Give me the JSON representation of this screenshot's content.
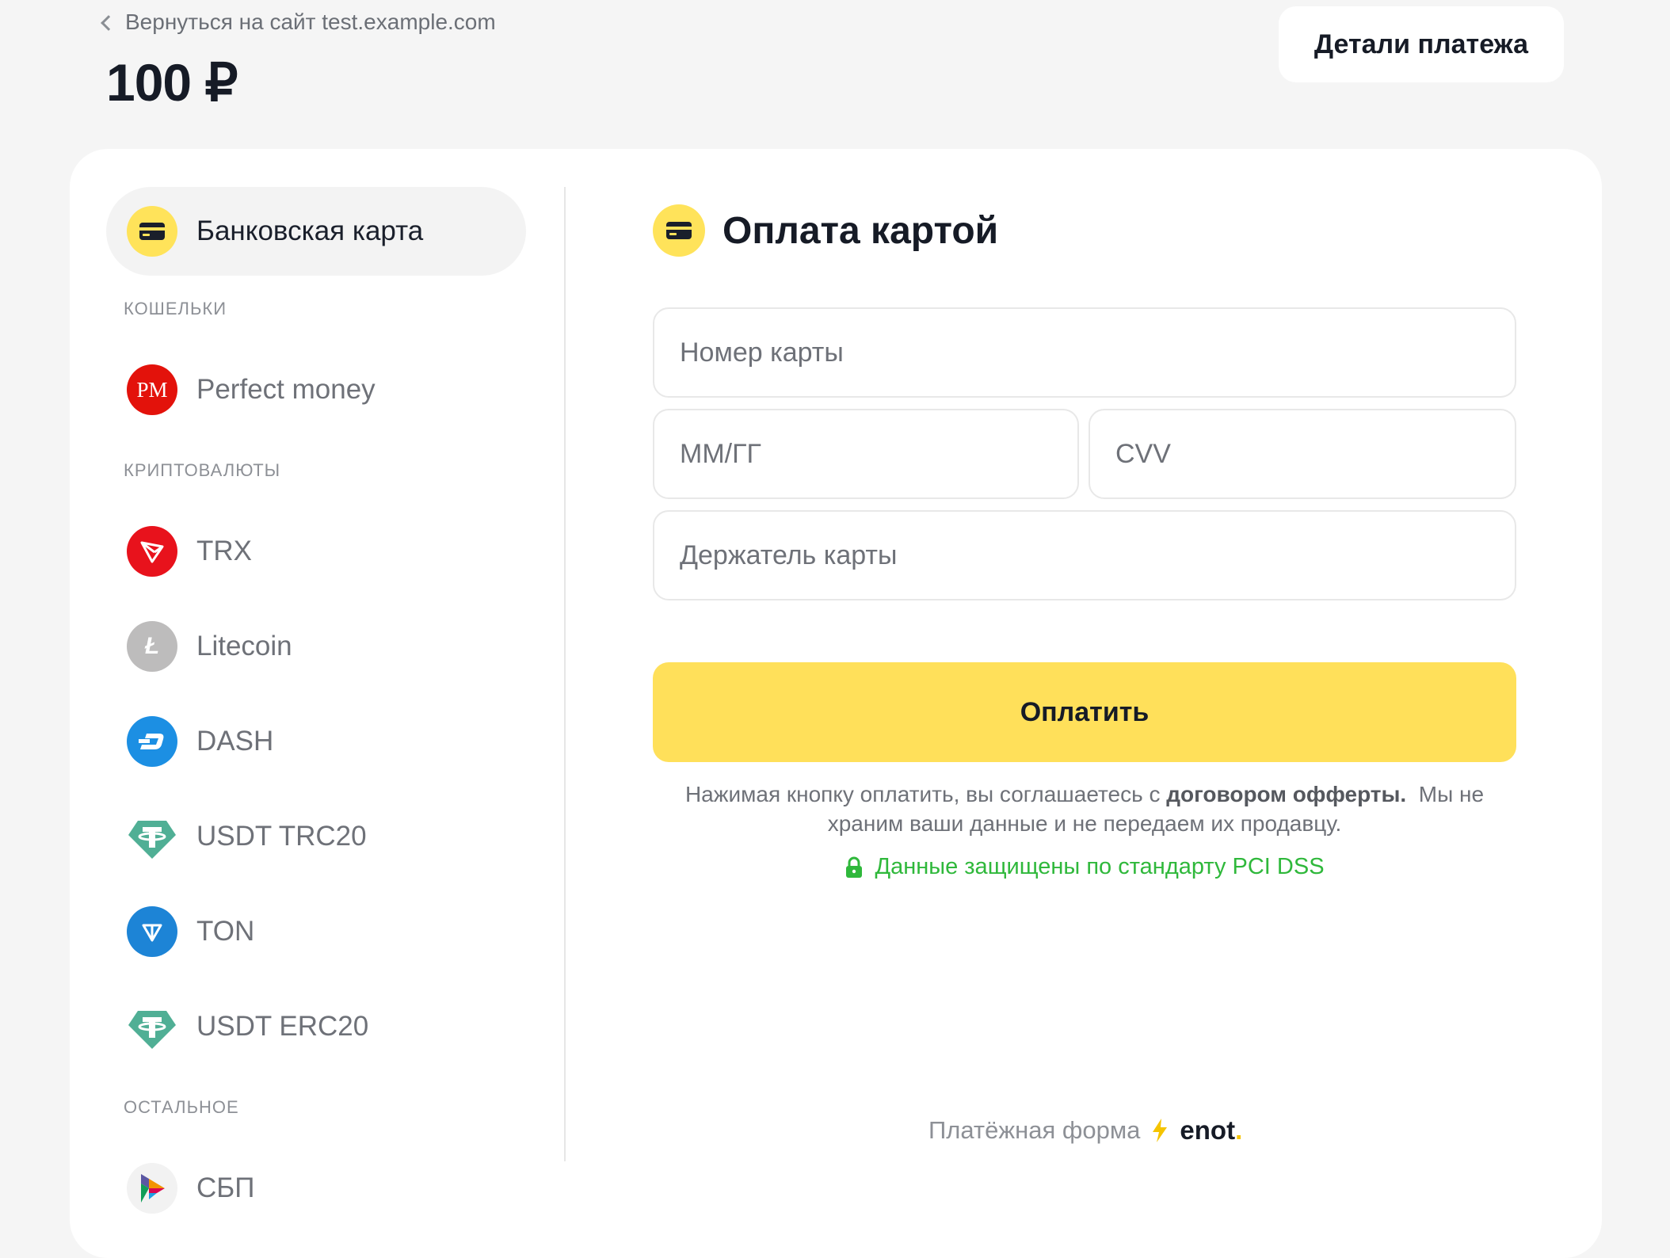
{
  "header": {
    "back_label": "Вернуться на сайт test.example.com",
    "amount": "100 ₽",
    "details_button": "Детали платежа"
  },
  "sidebar": {
    "active": {
      "label": "Банковская карта",
      "icon": "bank-card-icon"
    },
    "sections": [
      {
        "title": "КОШЕЛЬКИ",
        "items": [
          {
            "label": "Perfect money",
            "icon": "perfect-money-icon"
          }
        ]
      },
      {
        "title": "КРИПТОВАЛЮТЫ",
        "items": [
          {
            "label": "TRX",
            "icon": "trx-icon"
          },
          {
            "label": "Litecoin",
            "icon": "litecoin-icon"
          },
          {
            "label": "DASH",
            "icon": "dash-icon"
          },
          {
            "label": "USDT TRC20",
            "icon": "tether-icon"
          },
          {
            "label": "TON",
            "icon": "ton-icon"
          },
          {
            "label": "USDT ERC20",
            "icon": "tether-icon"
          }
        ]
      },
      {
        "title": "ОСТАЛЬНОЕ",
        "items": [
          {
            "label": "СБП",
            "icon": "sbp-icon"
          }
        ]
      }
    ]
  },
  "form": {
    "title": "Оплата картой",
    "card_number_placeholder": "Номер карты",
    "expiry_placeholder": "ММ/ГГ",
    "cvv_placeholder": "CVV",
    "holder_placeholder": "Держатель карты",
    "pay_button": "Оплатить",
    "note_prefix": "Нажимая кнопку оплатить, вы соглашаетесь с ",
    "note_link": "договором офферты.",
    "note_suffix": "  Мы не храним ваши данные и не передаем их продавцу.",
    "secure_text": "Данные защищены по стандарту PCI DSS"
  },
  "footer": {
    "label": "Платёжная форма",
    "brand": "enot",
    "brand_dot": "."
  },
  "colors": {
    "accent_yellow": "#ffe05a",
    "secure_green": "#2fb83b",
    "background": "#f5f5f5"
  }
}
